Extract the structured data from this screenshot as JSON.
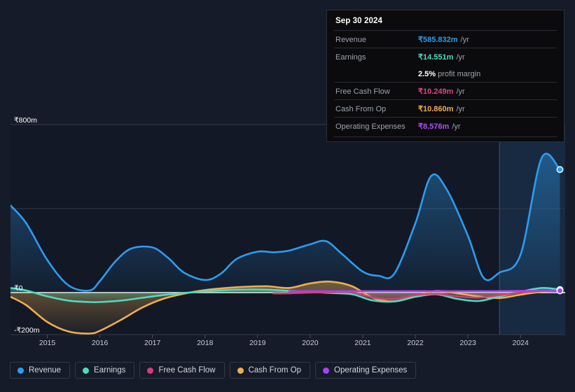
{
  "tooltip": {
    "title": "Sep 30 2024",
    "rows": [
      {
        "label": "Revenue",
        "value": "₹585.832m",
        "unit": "/yr",
        "color": "#2d9cf0"
      },
      {
        "label": "Earnings",
        "value": "₹14.551m",
        "unit": "/yr",
        "color": "#4ddbc0"
      },
      {
        "label": "Free Cash Flow",
        "value": "₹10.249m",
        "unit": "/yr",
        "color": "#e0447e"
      },
      {
        "label": "Cash From Op",
        "value": "₹10.860m",
        "unit": "/yr",
        "color": "#f0ad4e"
      },
      {
        "label": "Operating Expenses",
        "value": "₹8.576m",
        "unit": "/yr",
        "color": "#b14ef5"
      }
    ],
    "margin_value": "2.5%",
    "margin_label": "profit margin"
  },
  "legend": {
    "items": [
      {
        "label": "Revenue",
        "color": "#2d9cf0"
      },
      {
        "label": "Earnings",
        "color": "#4ddbc0"
      },
      {
        "label": "Free Cash Flow",
        "color": "#d93a7a"
      },
      {
        "label": "Cash From Op",
        "color": "#f0ad4e"
      },
      {
        "label": "Operating Expenses",
        "color": "#a742f5"
      }
    ]
  },
  "chart_data": {
    "type": "area",
    "title": "",
    "xlabel": "",
    "ylabel": "",
    "currency": "₹",
    "units": "m",
    "grid": true,
    "legend_position": "bottom",
    "ylim": [
      -200,
      800
    ],
    "ytick_labels": [
      "₹800m",
      "₹0",
      "-₹200m"
    ],
    "ytick_values": [
      800,
      0,
      -200
    ],
    "gridlines": [
      800,
      400,
      0,
      -200
    ],
    "xtick_labels": [
      "2015",
      "2016",
      "2017",
      "2018",
      "2019",
      "2020",
      "2021",
      "2022",
      "2023",
      "2024"
    ],
    "xlim": [
      2014.3,
      2024.85
    ],
    "forecast_start": "2023.6",
    "highlight_band_label": "forecast-region",
    "series": [
      {
        "name": "Revenue",
        "color": "#2d9cf0",
        "fill": true,
        "x": [
          2014.3,
          2014.6,
          2015.0,
          2015.4,
          2015.8,
          2016.0,
          2016.3,
          2016.6,
          2017.0,
          2017.3,
          2017.6,
          2018.0,
          2018.3,
          2018.6,
          2019.0,
          2019.3,
          2019.6,
          2020.0,
          2020.3,
          2020.6,
          2021.0,
          2021.3,
          2021.6,
          2022.0,
          2022.3,
          2022.6,
          2023.0,
          2023.3,
          2023.6,
          2024.0,
          2024.4,
          2024.75
        ],
        "y": [
          415,
          330,
          155,
          35,
          10,
          55,
          150,
          210,
          215,
          165,
          95,
          60,
          90,
          160,
          195,
          192,
          200,
          230,
          245,
          185,
          100,
          80,
          90,
          330,
          555,
          490,
          270,
          70,
          95,
          180,
          640,
          586
        ]
      },
      {
        "name": "Earnings",
        "color": "#4ddbc0",
        "fill": true,
        "x": [
          2014.3,
          2014.6,
          2015.0,
          2015.4,
          2015.8,
          2016.0,
          2016.4,
          2016.8,
          2017.2,
          2017.6,
          2018.0,
          2018.4,
          2018.8,
          2019.2,
          2019.6,
          2020.0,
          2020.4,
          2020.8,
          2021.2,
          2021.6,
          2022.0,
          2022.4,
          2022.8,
          2023.2,
          2023.6,
          2024.0,
          2024.4,
          2024.75
        ],
        "y": [
          22,
          10,
          -18,
          -38,
          -45,
          -45,
          -38,
          -25,
          -12,
          -2,
          6,
          12,
          15,
          14,
          8,
          3,
          -2,
          -8,
          -38,
          -42,
          -20,
          -8,
          -30,
          -40,
          -18,
          4,
          22,
          14.5
        ]
      },
      {
        "name": "Free Cash Flow",
        "color": "#d93a7a",
        "fill": true,
        "x": [
          2019.3,
          2019.6,
          2020.0,
          2020.4,
          2020.8,
          2021.2,
          2021.6,
          2022.0,
          2022.4,
          2022.8,
          2023.2,
          2023.6,
          2024.0,
          2024.4,
          2024.75
        ],
        "y": [
          -4,
          -3,
          0,
          2,
          1,
          -24,
          -30,
          -12,
          -6,
          -18,
          -24,
          -12,
          0,
          8,
          10.2
        ]
      },
      {
        "name": "Cash From Op",
        "color": "#f0ad4e",
        "fill": true,
        "x": [
          2014.3,
          2014.6,
          2015.0,
          2015.4,
          2015.8,
          2016.0,
          2016.4,
          2016.8,
          2017.2,
          2017.6,
          2018.0,
          2018.4,
          2018.8,
          2019.2,
          2019.6,
          2020.0,
          2020.4,
          2020.8,
          2021.2,
          2021.6,
          2022.0,
          2022.4,
          2022.8,
          2023.2,
          2023.6,
          2024.0,
          2024.4,
          2024.75
        ],
        "y": [
          -20,
          -60,
          -140,
          -185,
          -195,
          -182,
          -130,
          -72,
          -30,
          -5,
          12,
          22,
          28,
          30,
          22,
          44,
          52,
          30,
          -26,
          -42,
          -18,
          8,
          -4,
          -18,
          -26,
          -10,
          4,
          10.9
        ]
      },
      {
        "name": "Operating Expenses",
        "color": "#a742f5",
        "fill": false,
        "x": [
          2019.6,
          2020.0,
          2020.6,
          2021.2,
          2021.8,
          2022.4,
          2023.0,
          2023.6,
          2024.0,
          2024.4,
          2024.75
        ],
        "y": [
          6,
          7,
          7,
          7,
          7,
          7,
          7,
          7,
          8,
          8.5,
          8.6
        ]
      }
    ],
    "endpoints": [
      {
        "name": "Revenue",
        "value": 586,
        "color": "#2d9cf0"
      },
      {
        "name": "Earnings",
        "value": 14.5,
        "color": "#4ddbc0"
      },
      {
        "name": "Free Cash Flow",
        "value": 10.2,
        "color": "#d93a7a"
      },
      {
        "name": "Cash From Op",
        "value": 10.9,
        "color": "#f0ad4e"
      },
      {
        "name": "Operating Expenses",
        "value": 8.6,
        "color": "#a742f5"
      }
    ]
  }
}
